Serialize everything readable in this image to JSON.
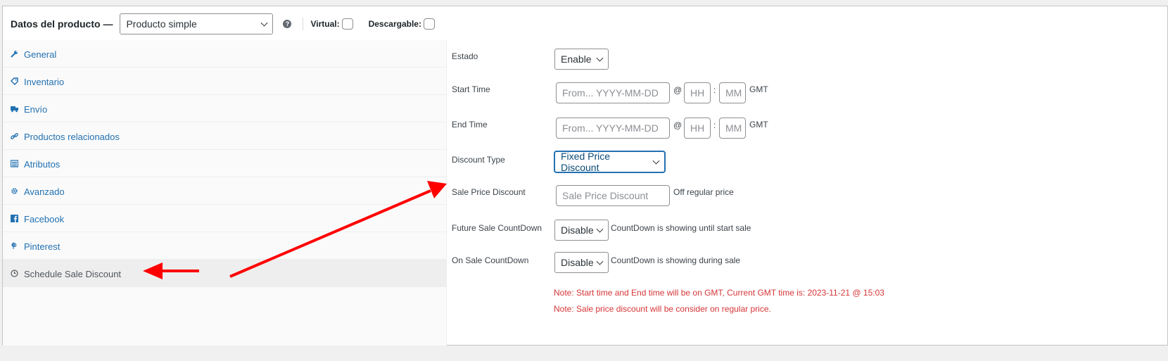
{
  "header": {
    "title": "Datos del producto —",
    "product_type": "Producto simple",
    "help_glyph": "?",
    "virtual_label": "Virtual:",
    "downloadable_label": "Descargable:"
  },
  "sidebar": {
    "items": [
      {
        "label": "General",
        "icon": "wrench-icon"
      },
      {
        "label": "Inventario",
        "icon": "tag-icon"
      },
      {
        "label": "Envío",
        "icon": "truck-icon"
      },
      {
        "label": "Productos relacionados",
        "icon": "link-icon"
      },
      {
        "label": "Atributos",
        "icon": "list-icon"
      },
      {
        "label": "Avanzado",
        "icon": "gear-icon"
      },
      {
        "label": "Facebook",
        "icon": "facebook-icon"
      },
      {
        "label": "Pinterest",
        "icon": "pinterest-icon"
      },
      {
        "label": "Schedule Sale Discount",
        "icon": "clock-icon",
        "active": true
      }
    ]
  },
  "form": {
    "estado_label": "Estado",
    "estado_value": "Enable",
    "start_time_label": "Start Time",
    "start_date_placeholder": "From... YYYY-MM-DD",
    "at_symbol": "@",
    "hour_placeholder": "HH",
    "colon": ":",
    "minute_placeholder": "MM",
    "gmt": "GMT",
    "end_time_label": "End Time",
    "end_date_placeholder": "From... YYYY-MM-DD",
    "discount_type_label": "Discount Type",
    "discount_type_value": "Fixed Price Discount",
    "sale_price_label": "Sale Price Discount",
    "sale_price_placeholder": "Sale Price Discount",
    "sale_price_suffix": "Off regular price",
    "future_countdown_label": "Future Sale CountDown",
    "future_countdown_value": "Disable",
    "future_countdown_note": "CountDown is showing until start sale",
    "on_sale_countdown_label": "On Sale CountDown",
    "on_sale_countdown_value": "Disable",
    "on_sale_countdown_note": "CountDown is showing during sale",
    "note_1": "Note: Start time and End time will be on GMT, Current GMT time is: 2023-11-21 @ 15:03",
    "note_2": "Note: Sale price discount will be consider on regular price."
  },
  "colors": {
    "link": "#2271b1",
    "note_red": "#d63638",
    "arrow_red": "#ff0000"
  }
}
